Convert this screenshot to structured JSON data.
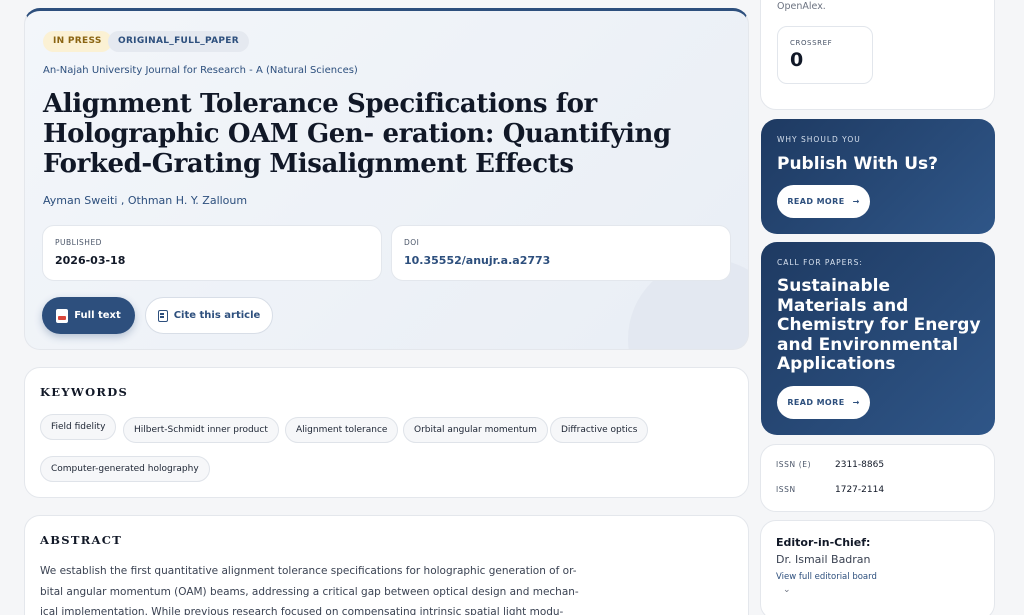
{
  "article": {
    "status_badge": "IN PRESS",
    "type_badge": "ORIGINAL_FULL_PAPER",
    "journal": "An-Najah University Journal for Research - A (Natural Sciences)",
    "title": "Alignment Tolerance Specifications for Holographic OAM Gen- eration: Quantifying Forked-Grating Misalignment Effects",
    "authors": "Ayman Sweiti , Othman H. Y. Zalloum",
    "published_label": "PUBLISHED",
    "published_value": "2026-03-18",
    "doi_label": "DOI",
    "doi_value": "10.35552/anujr.a.a2773",
    "full_text_label": "Full text",
    "cite_label": "Cite this article"
  },
  "keywords": {
    "heading": "KEYWORDS",
    "items": [
      "Field fidelity",
      "Hilbert-Schmidt inner product",
      "Alignment tolerance",
      "Orbital angular momentum",
      "Diffractive optics",
      "Computer-generated holography"
    ]
  },
  "abstract": {
    "heading": "ABSTRACT",
    "text": "We establish the first quantitative alignment tolerance specifications for holographic generation of or- bital angular momentum (OAM) beams, addressing a critical gap between optical design and mechan- ical implementation. While previous research focused on compensating intrinsic spatial light modu-"
  },
  "sidebar": {
    "metrics_note": "OpenAlex.",
    "crossref_label": "CROSSREF",
    "crossref_value": "0",
    "promo1": {
      "kicker": "WHY SHOULD YOU",
      "title": "Publish With Us?",
      "button": "READ MORE"
    },
    "promo2": {
      "kicker": "CALL FOR PAPERS:",
      "title": "Sustainable Materials and Chemistry for Energy and Environmental Applications",
      "button": "READ MORE"
    },
    "issn_e_label": "ISSN (E)",
    "issn_e_value": "2311-8865",
    "issn_label": "ISSN",
    "issn_value": "1727-2114",
    "editor_heading": "Editor-in-Chief:",
    "editor_name": "Dr. Ismail Badran",
    "editor_link": "View full editorial board"
  },
  "colors": {
    "accent": "#2d4f7d",
    "promo_dark": "#1e3a62",
    "badge_press_bg": "#fbf1d4",
    "pdf_red": "#d9463b"
  }
}
